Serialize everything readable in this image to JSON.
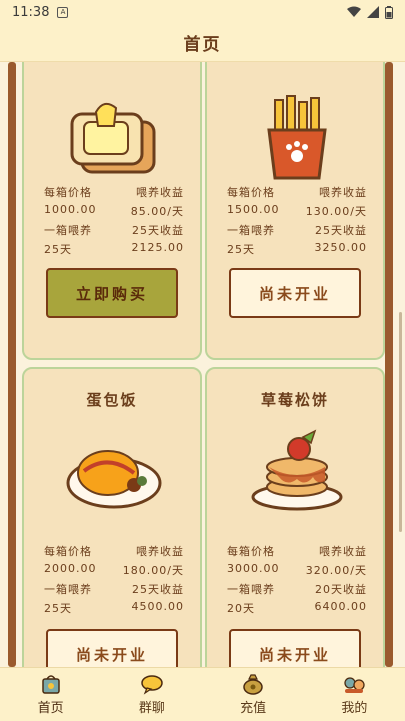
{
  "status": {
    "time": "11:38",
    "sim": "A"
  },
  "header": {
    "title": "首页"
  },
  "cards": [
    {
      "name": "",
      "food_icon": "toast-icon",
      "stats": [
        "每箱价格",
        "喂养收益",
        "1000.00",
        "85.00/天",
        "一箱喂养",
        "25天收益",
        "25天",
        "2125.00"
      ],
      "button": "立即购买",
      "button_state": "buy"
    },
    {
      "name": "",
      "food_icon": "fries-icon",
      "stats": [
        "每箱价格",
        "喂养收益",
        "1500.00",
        "130.00/天",
        "一箱喂养",
        "25天收益",
        "25天",
        "3250.00"
      ],
      "button": "尚未开业",
      "button_state": "closed"
    },
    {
      "name": "蛋包饭",
      "food_icon": "omelette-rice-icon",
      "stats": [
        "每箱价格",
        "喂养收益",
        "2000.00",
        "180.00/天",
        "一箱喂养",
        "25天收益",
        "25天",
        "4500.00"
      ],
      "button": "尚未开业",
      "button_state": "closed"
    },
    {
      "name": "草莓松饼",
      "food_icon": "strawberry-pancake-icon",
      "stats": [
        "每箱价格",
        "喂养收益",
        "3000.00",
        "320.00/天",
        "一箱喂养",
        "20天收益",
        "20天",
        "6400.00"
      ],
      "button": "尚未开业",
      "button_state": "closed"
    }
  ],
  "tabs": [
    {
      "label": "首页",
      "icon": "home-bag-icon"
    },
    {
      "label": "群聊",
      "icon": "chat-bubble-icon"
    },
    {
      "label": "充值",
      "icon": "money-bag-icon"
    },
    {
      "label": "我的",
      "icon": "profile-icon"
    }
  ]
}
